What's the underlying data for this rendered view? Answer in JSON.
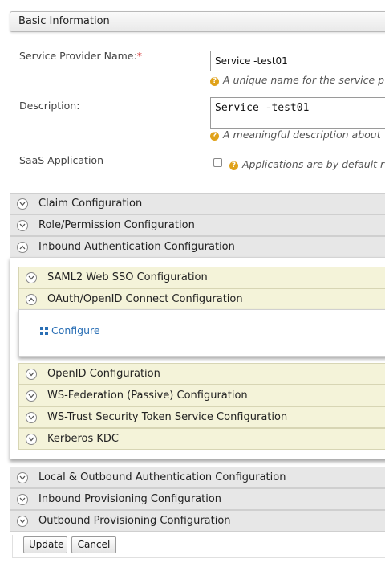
{
  "basic_info": {
    "header": "Basic Information",
    "sp_name_label": "Service Provider Name:",
    "required_mark": "*",
    "sp_name_value": "Service -test01",
    "sp_name_hint": "A unique name for the service p",
    "description_label": "Description:",
    "description_value": "Service -test01",
    "description_hint": "A meaningful description about",
    "saas_label": "SaaS Application",
    "saas_hint": "Applications are by default r",
    "saas_checked": false
  },
  "sections": {
    "claim": "Claim Configuration",
    "role": "Role/Permission Configuration",
    "inbound_auth": "Inbound Authentication Configuration",
    "local_outbound": "Local & Outbound Authentication Configuration",
    "inbound_prov": "Inbound Provisioning Configuration",
    "outbound_prov": "Outbound Provisioning Configuration"
  },
  "inbound_subsections": {
    "saml": "SAML2 Web SSO Configuration",
    "oauth": "OAuth/OpenID Connect Configuration",
    "oauth_configure_link": "Configure",
    "openid": "OpenID Configuration",
    "wsfed": "WS-Federation (Passive) Configuration",
    "wstrust": "WS-Trust Security Token Service Configuration",
    "kerberos": "Kerberos KDC"
  },
  "buttons": {
    "update": "Update",
    "cancel": "Cancel"
  },
  "colors": {
    "section_bg": "#e7e7e7",
    "subsection_bg": "#f4f3d9",
    "link": "#2a6fb5",
    "required": "#d32f2f",
    "help_icon": "#e0a21a"
  }
}
